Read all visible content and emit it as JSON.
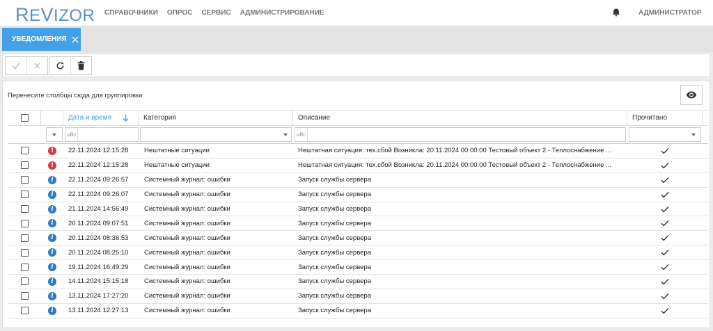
{
  "app": {
    "logo_first": "R",
    "logo_e": "E",
    "logo_v": "V",
    "logo_rest": "IZOR"
  },
  "nav": [
    "СПРАВОЧНИКИ",
    "ОПРОС",
    "СЕРВИС",
    "АДМИНИСТРИРОВАНИЕ"
  ],
  "user": "АДМИНИСТРАТОР",
  "tab": {
    "label": "УВЕДОМЛЕНИЯ"
  },
  "toolbar": {
    "icons": [
      "check-icon",
      "close-icon",
      "refresh-icon",
      "trash-icon"
    ]
  },
  "grid": {
    "group_hint": "Перенесите столбцы сюда для группировки",
    "columns": {
      "datetime": "Дата и время",
      "category": "Категория",
      "description": "Описание",
      "read": "Прочитано"
    },
    "sort": {
      "column": "datetime",
      "direction": "desc"
    },
    "rows": [
      {
        "type": "error",
        "datetime": "22.11.2024 12:15:28",
        "category": "Нештатные ситуации",
        "description": "Нештатная ситуация: тех.сбой Возникла: 20.11.2024 00:00:00 Тестовый объект 2 - Теплоснабжение ...",
        "read": true
      },
      {
        "type": "error",
        "datetime": "22.11.2024 12:15:28",
        "category": "Нештатные ситуации",
        "description": "Нештатная ситуация: тех.сбой Возникла: 20.11.2024 00:00:00 Тестовый объект 2 - Теплоснабжение ...",
        "read": true
      },
      {
        "type": "info",
        "datetime": "22.11.2024 09:26:57",
        "category": "Системный журнал: ошибки",
        "description": "Запуск службы сервера",
        "read": true
      },
      {
        "type": "info",
        "datetime": "22.11.2024 09:26:07",
        "category": "Системный журнал: ошибки",
        "description": "Запуск службы сервера",
        "read": true
      },
      {
        "type": "info",
        "datetime": "21.11.2024 14:56:49",
        "category": "Системный журнал: ошибки",
        "description": "Запуск службы сервера",
        "read": true
      },
      {
        "type": "info",
        "datetime": "20.11.2024 09:07:51",
        "category": "Системный журнал: ошибки",
        "description": "Запуск службы сервера",
        "read": true
      },
      {
        "type": "info",
        "datetime": "20.11.2024 08:36:53",
        "category": "Системный журнал: ошибки",
        "description": "Запуск службы сервера",
        "read": true
      },
      {
        "type": "info",
        "datetime": "20.11.2024 08:25:10",
        "category": "Системный журнал: ошибки",
        "description": "Запуск службы сервера",
        "read": true
      },
      {
        "type": "info",
        "datetime": "19.11.2024 16:49:29",
        "category": "Системный журнал: ошибки",
        "description": "Запуск службы сервера",
        "read": true
      },
      {
        "type": "info",
        "datetime": "14.11.2024 15:15:18",
        "category": "Системный журнал: ошибки",
        "description": "Запуск службы сервера",
        "read": true
      },
      {
        "type": "info",
        "datetime": "13.11.2024 17:27:20",
        "category": "Системный журнал: ошибки",
        "description": "Запуск службы сервера",
        "read": true
      },
      {
        "type": "info",
        "datetime": "13.11.2024 12:27:13",
        "category": "Системный журнал: ошибки",
        "description": "Запуск службы сервера",
        "read": true
      }
    ]
  },
  "icons": {
    "error_glyph": "!",
    "info_glyph": "i",
    "abc_glyph": "aBc"
  },
  "colors": {
    "accent": "#42a1e8",
    "error": "#d93a3a",
    "info": "#2e7bc4",
    "logo": "#5a8fc8"
  }
}
